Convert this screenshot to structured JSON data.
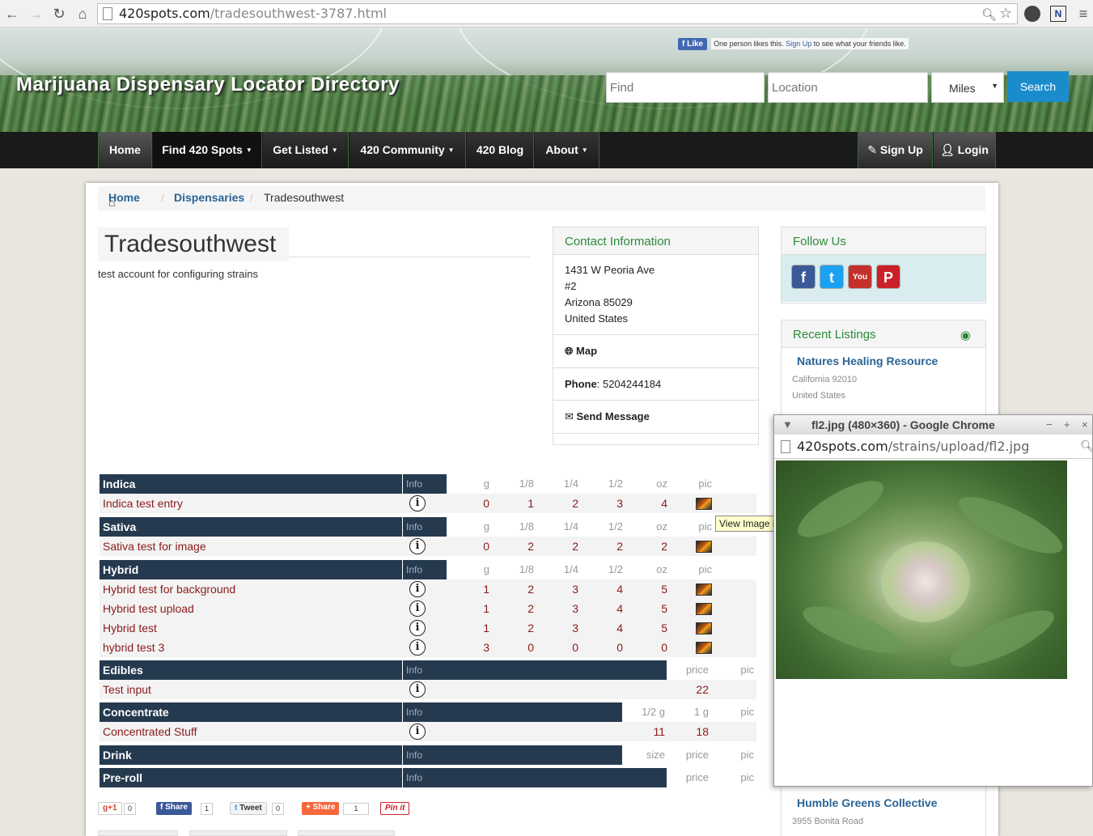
{
  "browser": {
    "url_domain": "420spots.com",
    "url_path": "/tradesouthwest-3787.html"
  },
  "header": {
    "site_title": "Marijuana Dispensary Locator Directory",
    "fb_like_label": "Like",
    "fb_like_text_pre": "One person likes this.",
    "fb_signup_link": "Sign Up",
    "fb_like_text_post": "to see what your friends like.",
    "find_placeholder": "Find",
    "location_placeholder": "Location",
    "distance_unit": "Miles",
    "search_label": "Search"
  },
  "nav": {
    "items": [
      {
        "label": "Home",
        "dropdown": false
      },
      {
        "label": "Find 420 Spots",
        "dropdown": true
      },
      {
        "label": "Get Listed",
        "dropdown": true
      },
      {
        "label": "420 Community",
        "dropdown": true
      },
      {
        "label": "420 Blog",
        "dropdown": false
      },
      {
        "label": "About",
        "dropdown": true
      }
    ],
    "signup_label": "Sign Up",
    "login_label": "Login"
  },
  "breadcrumb": {
    "home": "Home",
    "dispensaries": "Dispensaries",
    "current": "Tradesouthwest"
  },
  "business": {
    "name": "Tradesouthwest",
    "description": "test account for configuring strains"
  },
  "contact": {
    "heading": "Contact Information",
    "address_line1": "1431 W Peoria Ave",
    "address_line2": "#2",
    "address_line3": "Arizona 85029",
    "address_line4": "United States",
    "map_label": "Map",
    "phone_label": "Phone",
    "phone_value": ": 5204244184",
    "send_message_label": "Send Message"
  },
  "follow": {
    "heading": "Follow Us",
    "icons": [
      "facebook-icon",
      "twitter-icon",
      "youtube-icon",
      "pinterest-icon"
    ]
  },
  "recent": {
    "heading": "Recent Listings",
    "listings": [
      {
        "name": "Natures Healing Resource",
        "line1": "California 92010",
        "line2": "United States"
      },
      {
        "name": "Humble Greens Collective",
        "line1": "3955 Bonita Road",
        "line2": ""
      }
    ]
  },
  "menu": {
    "info_label": "Info",
    "weight_headers": [
      "g",
      "1/8",
      "1/4",
      "1/2",
      "oz",
      "pic"
    ],
    "categories": [
      {
        "name": "Indica",
        "strains": [
          {
            "name": "Indica test entry",
            "values": [
              "0",
              "1",
              "2",
              "3",
              "4"
            ]
          }
        ]
      },
      {
        "name": "Sativa",
        "strains": [
          {
            "name": "Sativa test for image",
            "values": [
              "0",
              "2",
              "2",
              "2",
              "2"
            ]
          }
        ]
      },
      {
        "name": "Hybrid",
        "strains": [
          {
            "name": "Hybrid test for background",
            "values": [
              "1",
              "2",
              "3",
              "4",
              "5"
            ]
          },
          {
            "name": "Hybrid test upload",
            "values": [
              "1",
              "2",
              "3",
              "4",
              "5"
            ]
          },
          {
            "name": "Hybrid test",
            "values": [
              "1",
              "2",
              "3",
              "4",
              "5"
            ]
          },
          {
            "name": "hybrid test 3",
            "values": [
              "3",
              "0",
              "0",
              "0",
              "0"
            ]
          }
        ]
      }
    ],
    "edibles": {
      "name": "Edibles",
      "headers": [
        "price",
        "pic"
      ],
      "items": [
        {
          "name": "Test input",
          "price": "22"
        }
      ]
    },
    "concentrate": {
      "name": "Concentrate",
      "headers": [
        "1/2 g",
        "1 g",
        "pic"
      ],
      "items": [
        {
          "name": "Concentrated Stuff",
          "half_g": "11",
          "one_g": "18"
        }
      ]
    },
    "drink": {
      "name": "Drink",
      "headers": [
        "size",
        "price",
        "pic"
      ]
    },
    "preroll": {
      "name": "Pre-roll",
      "headers": [
        "price",
        "pic"
      ]
    },
    "tooltip": "View Image if Available"
  },
  "share": {
    "gplus_label": "+1",
    "gplus_count": "0",
    "fb_share_label": "Share",
    "fb_share_count": "1",
    "tweet_label": "Tweet",
    "tweet_count": "0",
    "addthis_label": "Share",
    "addthis_count": "1",
    "pinit_label": "Pin it"
  },
  "popup": {
    "title": "fl2.jpg (480×360) - Google Chrome",
    "url_domain": "420spots.com",
    "url_path": "/strains/upload/fl2.jpg"
  }
}
